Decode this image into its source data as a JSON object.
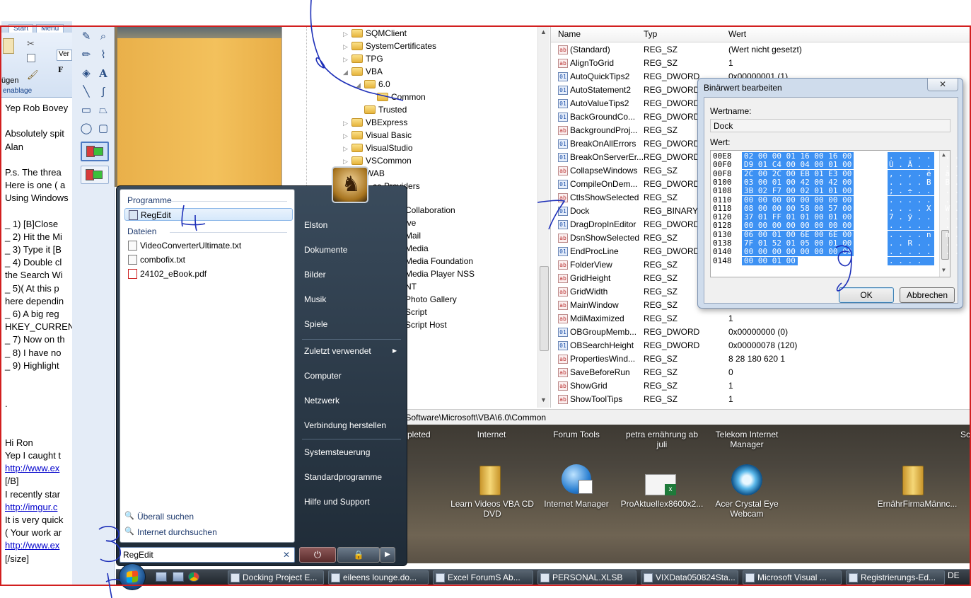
{
  "word": {
    "tabs": [
      "Start",
      "Menü"
    ],
    "clipboard_label": "enablage",
    "paste_label": "ügen",
    "font_box": "Ver",
    "bold": "F",
    "lines": [
      "Yep Rob Bovey",
      "",
      "Absolutely spit",
      "Alan",
      "",
      "P.s. The threa",
      "Here is one ( a",
      "Using Windows",
      "",
      "_ 1) [B]Close",
      "_ 2) Hit the Mi",
      "_ 3) Type it [B",
      "_ 4) Double cl",
      "the Search Wi",
      "_ 5)( At this p",
      "here dependin",
      "_ 6) A big reg",
      "HKEY_CURREN",
      "_ 7) Now on th",
      "_ 8) I have no",
      "_ 9) Highlight",
      "",
      "",
      "        .",
      "",
      "",
      "Hi Ron",
      "Yep I caught t",
      "http://www.ex",
      "[/B]",
      "I recently star",
      "http://imgur.c",
      "It is very quick",
      "( Your work ar",
      "http://www.ex",
      "[/size]"
    ]
  },
  "tree": {
    "items": [
      {
        "label": "SQMClient",
        "indent": 0,
        "arrow": "▷"
      },
      {
        "label": "SystemCertificates",
        "indent": 0,
        "arrow": "▷"
      },
      {
        "label": "TPG",
        "indent": 0,
        "arrow": "▷"
      },
      {
        "label": "VBA",
        "indent": 0,
        "arrow": "◢"
      },
      {
        "label": "6.0",
        "indent": 1,
        "arrow": "◢"
      },
      {
        "label": "Common",
        "indent": 2,
        "arrow": ""
      },
      {
        "label": "Trusted",
        "indent": 1,
        "arrow": ""
      },
      {
        "label": "VBExpress",
        "indent": 0,
        "arrow": "▷"
      },
      {
        "label": "Visual Basic",
        "indent": 0,
        "arrow": "▷"
      },
      {
        "label": "VisualStudio",
        "indent": 0,
        "arrow": "▷"
      },
      {
        "label": "VSCommon",
        "indent": 0,
        "arrow": "▷"
      },
      {
        "label": "WAB",
        "indent": 0,
        "arrow": "▷"
      },
      {
        "label": "...ce Providers",
        "indent": 0,
        "arrow": ""
      }
    ],
    "partial": [
      "Collaboration",
      "ive",
      "Mail",
      "Media",
      "Media Foundation",
      "Media Player NSS",
      "NT",
      "Photo Gallery",
      "Script",
      "Script Host"
    ]
  },
  "reglist": {
    "headers": {
      "name": "Name",
      "type": "Typ",
      "value": "Wert"
    },
    "rows": [
      {
        "name": "(Standard)",
        "type": "REG_SZ",
        "value": "(Wert nicht gesetzt)"
      },
      {
        "name": "AlignToGrid",
        "type": "REG_SZ",
        "value": "1"
      },
      {
        "name": "AutoQuickTips2",
        "type": "REG_DWORD",
        "value": "0x00000001 (1)"
      },
      {
        "name": "AutoStatement2",
        "type": "REG_DWORD",
        "value": ""
      },
      {
        "name": "AutoValueTips2",
        "type": "REG_DWORD",
        "value": ""
      },
      {
        "name": "BackGroundCo...",
        "type": "REG_DWORD",
        "value": ""
      },
      {
        "name": "BackgroundProj...",
        "type": "REG_SZ",
        "value": ""
      },
      {
        "name": "BreakOnAllErrors",
        "type": "REG_DWORD",
        "value": ""
      },
      {
        "name": "BreakOnServerEr...",
        "type": "REG_DWORD",
        "value": ""
      },
      {
        "name": "CollapseWindows",
        "type": "REG_SZ",
        "value": ""
      },
      {
        "name": "CompileOnDem...",
        "type": "REG_DWORD",
        "value": ""
      },
      {
        "name": "CtlsShowSelected",
        "type": "REG_SZ",
        "value": ""
      },
      {
        "name": "Dock",
        "type": "REG_BINARY",
        "value": ""
      },
      {
        "name": "DragDropInEditor",
        "type": "REG_DWORD",
        "value": ""
      },
      {
        "name": "DsnShowSelected",
        "type": "REG_SZ",
        "value": ""
      },
      {
        "name": "EndProcLine",
        "type": "REG_DWORD",
        "value": ""
      },
      {
        "name": "FolderView",
        "type": "REG_SZ",
        "value": ""
      },
      {
        "name": "GridHeight",
        "type": "REG_SZ",
        "value": ""
      },
      {
        "name": "GridWidth",
        "type": "REG_SZ",
        "value": ""
      },
      {
        "name": "MainWindow",
        "type": "REG_SZ",
        "value": "164 355 1345 722 1"
      },
      {
        "name": "MdiMaximized",
        "type": "REG_SZ",
        "value": "1"
      },
      {
        "name": "OBGroupMemb...",
        "type": "REG_DWORD",
        "value": "0x00000000 (0)"
      },
      {
        "name": "OBSearchHeight",
        "type": "REG_DWORD",
        "value": "0x00000078 (120)"
      },
      {
        "name": "PropertiesWind...",
        "type": "REG_SZ",
        "value": "8 28 180 620 1"
      },
      {
        "name": "SaveBeforeRun",
        "type": "REG_SZ",
        "value": "0"
      },
      {
        "name": "ShowGrid",
        "type": "REG_SZ",
        "value": "1"
      },
      {
        "name": "ShowToolTips",
        "type": "REG_SZ",
        "value": "1"
      }
    ]
  },
  "statusbar": "\\Software\\Microsoft\\VBA\\6.0\\Common",
  "dialog": {
    "title": "Binärwert bearbeiten",
    "close": "✕",
    "name_label": "Wertname:",
    "name_value": "Dock",
    "value_label": "Wert:",
    "hex_rows": [
      {
        "off": "00E8",
        "hex": "02 00 00 01 16 00 16 00",
        "asc": ". . . . . . . ."
      },
      {
        "off": "00F0",
        "hex": "D9 01 C4 00 04 00 01 00",
        "asc": "Ù . Ä . . . . ."
      },
      {
        "off": "00F8",
        "hex": "2C 00 2C 00 EB 01 E3 00",
        "asc": ", . , . ë . ã ."
      },
      {
        "off": "0100",
        "hex": "03 00 01 00 42 00 42 00",
        "asc": ". . . . B . B ."
      },
      {
        "off": "0108",
        "hex": "3B 02 F7 00 02 01 01 00",
        "asc": "; . ÷ . . . . ."
      },
      {
        "off": "0110",
        "hex": "00 00 00 00 00 00 00 00",
        "asc": ". . . . . . . ."
      },
      {
        "off": "0118",
        "hex": "08 00 00 00 58 00 57 00",
        "asc": ". . . . X . W ."
      },
      {
        "off": "0120",
        "hex": "37 01 FF 01 01 00 01 00",
        "asc": "7 . ÿ . . . . ."
      },
      {
        "off": "0128",
        "hex": "00 00 00 00 00 00 00 00",
        "asc": ". . . . . . . ."
      },
      {
        "off": "0130",
        "hex": "06 00 01 00 6E 00 6E 00",
        "asc": ". . . . n . n ."
      },
      {
        "off": "0138",
        "hex": "7F 01 52 01 05 00 01 00",
        "asc": ". . R . . . . ."
      },
      {
        "off": "0140",
        "hex": "00 00 00 00 00 00 00 00",
        "asc": ". . . . . . . ."
      },
      {
        "off": "0148",
        "hex": "00 00 01 00",
        "asc": ". . . ."
      }
    ],
    "ok": "OK",
    "cancel": "Abbrechen"
  },
  "desktop": {
    "top_labels": [
      "pleted",
      "Internet",
      "Forum Tools",
      "petra ernährung ab juli",
      "Telekom Internet Manager",
      "Sc"
    ],
    "icons": [
      "Learn Videos VBA CD DVD",
      "Internet Manager",
      "ProAktuellex8600x2...",
      "Acer Crystal Eye Webcam",
      "ErnährFirmaMännc..."
    ]
  },
  "startmenu": {
    "programs_header": "Programme",
    "files_header": "Dateien",
    "program_items": [
      "RegEdit"
    ],
    "file_items": [
      "VideoConverterUltimate.txt",
      "combofix.txt",
      "24102_eBook.pdf"
    ],
    "search_everywhere": "Überall suchen",
    "search_internet": "Internet durchsuchen",
    "search_value": "RegEdit",
    "clear": "✕",
    "right_items": [
      "Elston",
      "Dokumente",
      "Bilder",
      "Musik",
      "Spiele",
      "Zuletzt verwendet",
      "Computer",
      "Netzwerk",
      "Verbindung herstellen",
      "Systemsteuerung",
      "Standardprogramme",
      "Hilfe und Support"
    ],
    "power": "⏻",
    "lock": "🔒",
    "more": "▶"
  },
  "taskbar": {
    "tasks": [
      "Docking Project E...",
      "eileens lounge.do...",
      "Excel ForumS Ab...",
      "PERSONAL.XLSB",
      "VIXData050824Sta...",
      "Microsoft Visual ...",
      "Registrierungs-Ed..."
    ],
    "tray": "DE"
  },
  "annotations": [
    "6",
    "4",
    "7",
    "9",
    "3"
  ]
}
